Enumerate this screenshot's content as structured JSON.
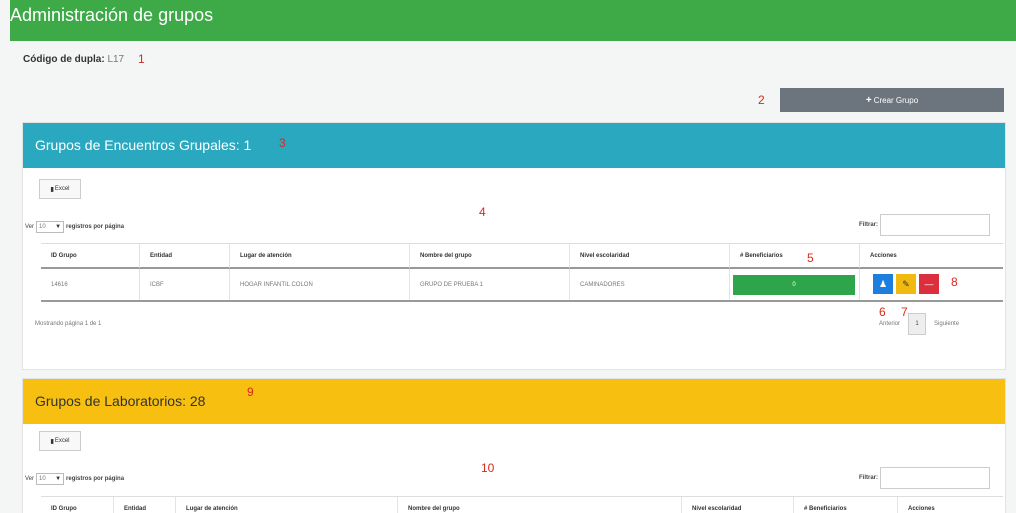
{
  "page": {
    "title": "Administración de grupos"
  },
  "dupla": {
    "label": "Código de dupla:",
    "value": "L17"
  },
  "create_button": {
    "plus": "+",
    "label": "Crear Grupo"
  },
  "annotations": {
    "n1": "1",
    "n2": "2",
    "n3": "3",
    "n4": "4",
    "n5": "5",
    "n6": "6",
    "n7": "7",
    "n8": "8",
    "n9": "9",
    "n10": "10"
  },
  "section1": {
    "title": "Grupos de Encuentros Grupales: 1",
    "excel_label": "Excel",
    "ver_label": "Ver",
    "per_page_value": "10",
    "per_page_suffix": "registros por página",
    "filter_label": "Filtrar:",
    "columns": [
      "ID Grupo",
      "Entidad",
      "Lugar de atención",
      "Nombre del grupo",
      "Nivel escolaridad",
      "# Beneficiarios",
      "Acciones"
    ],
    "row": {
      "id": "14616",
      "entidad": "ICBF",
      "lugar": "HOGAR INFANTIL COLON",
      "nombre": "GRUPO DE PRUEBA 1",
      "nivel": "CAMINADORES",
      "beneficiarios": "0"
    },
    "showing": "Mostrando página 1 de 1",
    "pager": {
      "prev": "Anterior",
      "page": "1",
      "next": "Siguiente"
    }
  },
  "section2": {
    "title": "Grupos de Laboratorios: 28",
    "excel_label": "Excel",
    "ver_label": "Ver",
    "per_page_value": "10",
    "per_page_suffix": "registros por página",
    "filter_label": "Filtrar:",
    "columns": [
      "ID Grupo",
      "Entidad",
      "Lugar de atención",
      "Nombre del grupo",
      "Nivel escolaridad",
      "# Beneficiarios",
      "Acciones"
    ]
  },
  "icons": {
    "add_user": "add-user-icon",
    "edit": "edit-icon",
    "remove": "minus-icon",
    "excel": "file-icon"
  },
  "colors": {
    "header_green": "#3daa47",
    "section1_teal": "#2aa8bf",
    "section2_yellow": "#f7c010",
    "button_gray": "#6c757d",
    "beneficiarios_green": "#2ea54a",
    "action_blue": "#1c7fe0",
    "action_yellow": "#f2b90f",
    "action_red": "#dc2f3d",
    "annotation_red": "#d9291c"
  }
}
